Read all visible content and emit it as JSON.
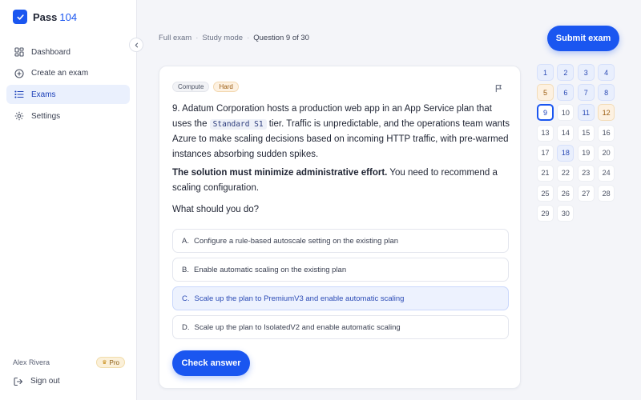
{
  "brand": {
    "name": "Pass",
    "number": "104"
  },
  "nav": [
    {
      "label": "Dashboard",
      "icon": "dashboard-icon",
      "active": false
    },
    {
      "label": "Create an exam",
      "icon": "plus-circle-icon",
      "active": false
    },
    {
      "label": "Exams",
      "icon": "list-icon",
      "active": true
    },
    {
      "label": "Settings",
      "icon": "gear-icon",
      "active": false
    }
  ],
  "user": {
    "name": "Alex Rivera",
    "plan": "Pro"
  },
  "signout_label": "Sign out",
  "breadcrumb": {
    "part1": "Full exam",
    "part2": "Study mode",
    "current": "Question 9 of 30"
  },
  "submit_label": "Submit exam",
  "question": {
    "topic_tag": "Compute",
    "difficulty_tag": "Hard",
    "text_before": "9. Adatum Corporation hosts a production web app in an App Service plan that uses the ",
    "code": "Standard S1",
    "text_after": " tier. Traffic is unpredictable, and the operations team wants Azure to make scaling decisions based on incoming HTTP traffic, with pre-warmed instances absorbing sudden spikes.",
    "requirement_bold": "The solution must minimize administrative effort.",
    "requirement_rest": " You need to recommend a scaling configuration.",
    "ask": "What should you do?",
    "options": [
      {
        "letter": "A.",
        "text": "Configure a rule-based autoscale setting on the existing plan",
        "selected": false
      },
      {
        "letter": "B.",
        "text": "Enable automatic scaling on the existing plan",
        "selected": false
      },
      {
        "letter": "C.",
        "text": "Scale up the plan to PremiumV3 and enable automatic scaling",
        "selected": true
      },
      {
        "letter": "D.",
        "text": "Scale up the plan to IsolatedV2 and enable automatic scaling",
        "selected": false
      }
    ]
  },
  "check_label": "Check answer",
  "question_grid": [
    {
      "n": "1",
      "state": "answered"
    },
    {
      "n": "2",
      "state": "answered"
    },
    {
      "n": "3",
      "state": "answered"
    },
    {
      "n": "4",
      "state": "answered"
    },
    {
      "n": "5",
      "state": "flagged"
    },
    {
      "n": "6",
      "state": "answered"
    },
    {
      "n": "7",
      "state": "answered"
    },
    {
      "n": "8",
      "state": "answered"
    },
    {
      "n": "9",
      "state": "current"
    },
    {
      "n": "10",
      "state": "default"
    },
    {
      "n": "11",
      "state": "answered"
    },
    {
      "n": "12",
      "state": "flagged"
    },
    {
      "n": "13",
      "state": "default"
    },
    {
      "n": "14",
      "state": "default"
    },
    {
      "n": "15",
      "state": "default"
    },
    {
      "n": "16",
      "state": "default"
    },
    {
      "n": "17",
      "state": "default"
    },
    {
      "n": "18",
      "state": "answered"
    },
    {
      "n": "19",
      "state": "default"
    },
    {
      "n": "20",
      "state": "default"
    },
    {
      "n": "21",
      "state": "default"
    },
    {
      "n": "22",
      "state": "default"
    },
    {
      "n": "23",
      "state": "default"
    },
    {
      "n": "24",
      "state": "default"
    },
    {
      "n": "25",
      "state": "default"
    },
    {
      "n": "26",
      "state": "default"
    },
    {
      "n": "27",
      "state": "default"
    },
    {
      "n": "28",
      "state": "default"
    },
    {
      "n": "29",
      "state": "default"
    },
    {
      "n": "30",
      "state": "default"
    }
  ],
  "colors": {
    "accent": "#1a56f0",
    "flag": "#fdf1e1",
    "answered": "#e9effd"
  }
}
